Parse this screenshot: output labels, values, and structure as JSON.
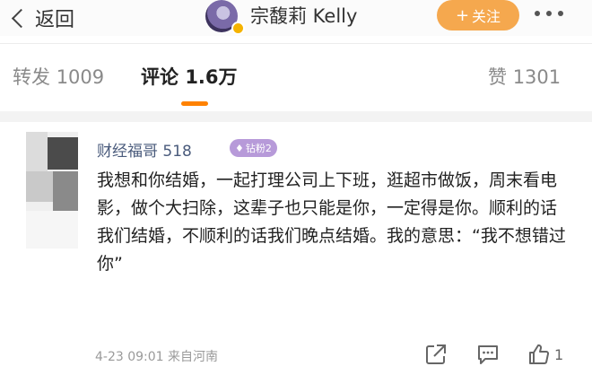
{
  "header": {
    "back_label": "返回",
    "username": "宗馥莉 Kelly",
    "follow_label": "关注"
  },
  "tabs": [
    {
      "label": "转发",
      "count": "1009"
    },
    {
      "label": "评论",
      "count": "1.6万"
    },
    {
      "label": "赞",
      "count": "1301"
    }
  ],
  "comment": {
    "author": "财经福哥 518",
    "badge": "钻粉2",
    "text": "我想和你结婚，一起打理公司上下班，逛超市做饭，周末看电影，做个大扫除，这辈子也只能是你，一定得是你。顺利的话我们结婚，不顺利的话我们晚点结婚。我的意思：“我不想错过你”",
    "time": "4-23 09:01",
    "location": "来自河南",
    "like_count": "1"
  },
  "icons": [
    "back-icon",
    "verified-badge-icon",
    "plus-icon",
    "more-icon",
    "diamond-icon",
    "share-icon",
    "reply-icon",
    "like-icon"
  ],
  "colors": {
    "accent": "#ff8200",
    "follow_bg": "#f5a84e",
    "name_link": "#4a5b7c",
    "fan_badge": "#b79ad9"
  }
}
